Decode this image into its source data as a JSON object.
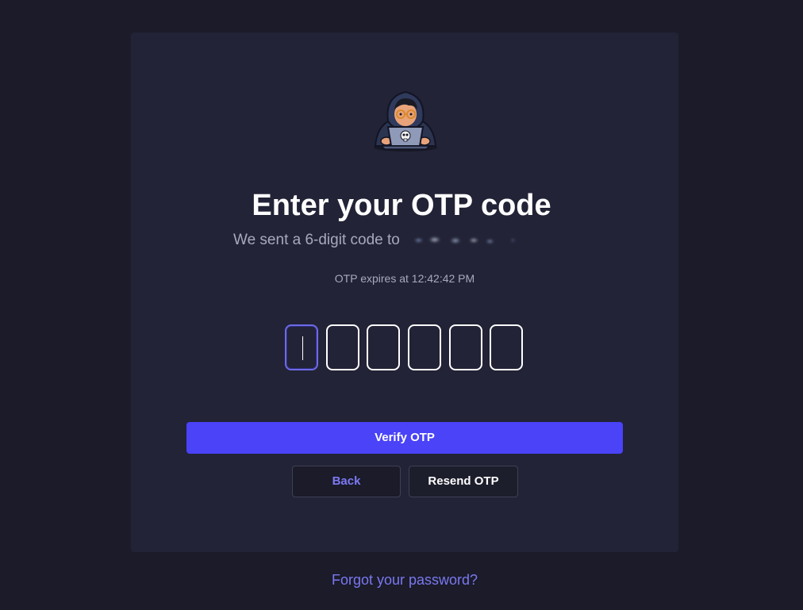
{
  "auth": {
    "title": "Enter your OTP code",
    "subtitle_prefix": "We sent a 6-digit code to",
    "expires_text": "OTP expires at 12:42:42 PM",
    "otp_digits": [
      "",
      "",
      "",
      "",
      "",
      ""
    ],
    "verify_label": "Verify OTP",
    "back_label": "Back",
    "resend_label": "Resend OTP"
  },
  "footer": {
    "forgot_label": "Forgot your password?"
  },
  "colors": {
    "page_bg": "#1b1b29",
    "card_bg": "#222336",
    "primary": "#4a43f8",
    "link": "#7a78f0"
  },
  "icons": {
    "avatar": "hacker-avatar-icon"
  }
}
